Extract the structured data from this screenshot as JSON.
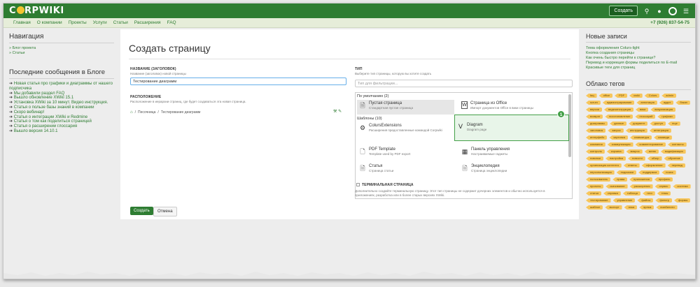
{
  "brand": {
    "logo": "CORPWIKI"
  },
  "topbar": {
    "create_label": "Создать"
  },
  "nav": {
    "items": [
      "Главная",
      "О компании",
      "Проекты",
      "Услуги",
      "Статьи",
      "Расширения",
      "FAQ"
    ],
    "phone": "+7 (926) 837-54-75"
  },
  "left": {
    "nav_title": "Навигация",
    "nav_links": [
      "» Блог проекта",
      "» Статьи"
    ],
    "blog_title": "Последние сообщения в Блоге",
    "news": [
      "Новая статья про графики и диаграммы от нашего подписчика",
      "Мы добавили раздел FAQ",
      "Вышло обновление XWiki 15.1",
      "Установка XWiki за 10 минут. Видео инструкция.",
      "Статья о пользе базы знаний в компании",
      "Скоро вебинар!",
      "Статья о интеграции XWiki и Redmine",
      "Статья о том как поделиться страницей",
      "Статья о расширении глоссария",
      "Вышло версия 14.10.1"
    ]
  },
  "main": {
    "title": "Создать страницу",
    "name_label": "НАЗВАНИЕ (ЗАГОЛОВОК)",
    "name_hint": "Название (заголовок) новой страницы",
    "name_value": "Тестирование диаграмм",
    "location_label": "РАСПОЛОЖЕНИЕ",
    "location_hint": "Расположение в иерархии страниц, где будет создаваться эта новая страница.",
    "location_path": [
      "Песочница",
      "Тестирование диаграмм"
    ],
    "type_label": "ТИП",
    "type_hint": "Выберите тип страницы, которую вы хотите создать",
    "type_filter_placeholder": "Тип для фильтрации...",
    "group_default": "По умолчанию (2)",
    "group_templates": "Шаблоны (10)",
    "types": {
      "empty": {
        "name": "Пустая страница",
        "desc": "Стандартная пустая страница"
      },
      "office": {
        "name": "Страница из Office",
        "desc": "Импорт документов Office в вики страницы"
      },
      "colurs": {
        "name": "ColursExtensions",
        "desc": "Расширения предоставленные командой Corpwiki"
      },
      "diagram": {
        "name": "Diagram",
        "desc": "Diagram page"
      },
      "pdf": {
        "name": "PDF Template",
        "desc": "Template used by PDF export"
      },
      "dashboard": {
        "name": "Панель управления",
        "desc": "Настраиваемые гаджеты"
      },
      "article": {
        "name": "Статья",
        "desc": "Страница статьи"
      },
      "encyclopedia": {
        "name": "Энциклопедия",
        "desc": "Страница энциклопедии"
      }
    },
    "badge": "1",
    "terminal_label": "ТЕРМИНАЛЬНАЯ СТРАНИЦА",
    "terminal_hint": "Дополнительно создайте терминальную страницу. Этот тип страницы не содержит дочерних элементов и обычно используется в приложениях, разработка или в более старых версиях XWiki.",
    "create_label": "Создать",
    "cancel_label": "Отмена"
  },
  "right": {
    "recent_title": "Новые записи",
    "recent": [
      "Тема оформления Colurs-light",
      "Кнопка создания страницы",
      "Как очень быстро перейти к странице?",
      "Перевод и коррекция формы поделиться по E-mail",
      "Красивые теги для страниц"
    ],
    "tags_title": "Облако тегов",
    "tags": [
      "faq",
      "office",
      "PDF",
      "xwiki",
      "Colurs",
      "admin",
      "scrum",
      "адмиистрирование",
      "аннотация",
      "аудит",
      "бэкап",
      "версии",
      "видеоинструкция",
      "вики",
      "визуализация",
      "возврат",
      "восстановление",
      "глоссарий",
      "графики",
      "диаграммы",
      "данные",
      "документ",
      "доступ",
      "еще",
      "заголовок",
      "запрос",
      "инструкция",
      "интеграция",
      "интерфейс",
      "картинка",
      "клавиатура",
      "команда",
      "компания",
      "коммуникация",
      "комментирование",
      "контакты",
      "контроль",
      "корзина",
      "макрос",
      "меню",
      "модификация",
      "новинки",
      "настройка",
      "новости",
      "обзор",
      "обучение",
      "организация контента",
      "ответы",
      "оформление",
      "перевод",
      "персонализация",
      "подсказки",
      "поддержка",
      "поиск",
      "пользователь",
      "права",
      "приложения",
      "профиль",
      "проекты",
      "скачивание",
      "расширения",
      "сервис",
      "система",
      "статья",
      "справка",
      "таблица",
      "теги",
      "темы",
      "тестирование",
      "управление",
      "файлы",
      "фильтр",
      "формы",
      "шаблон",
      "экспорт",
      "язык",
      "ярлык",
      "юзабилити"
    ]
  }
}
